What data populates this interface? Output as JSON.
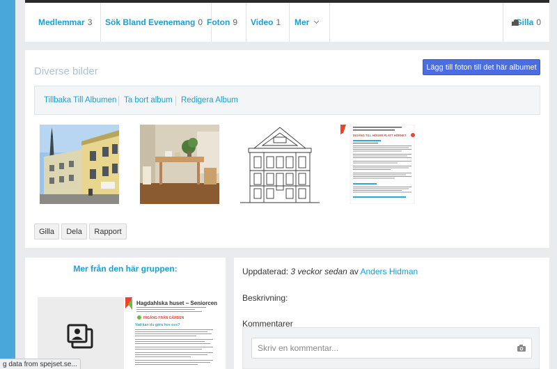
{
  "tabs": [
    {
      "label": "Medlemmar",
      "count": "3"
    },
    {
      "label": "Sök Bland Evenemang",
      "count": "0"
    },
    {
      "label": "Foton",
      "count": "9"
    },
    {
      "label": "Video",
      "count": "1"
    },
    {
      "label": "Mer",
      "count": ""
    }
  ],
  "like": {
    "label": "Gilla",
    "count": "0"
  },
  "album": {
    "title": "Diverse bilder",
    "add_photos_label": "Lägg till foton till det här albumet",
    "nav": [
      "Tillbaka Till Albumen",
      "Ta bort album",
      "Redigera Album"
    ],
    "actions": [
      "Gilla",
      "Dela",
      "Rapport"
    ],
    "doc_heading": "INGÅNG TILL HÖGER PLATT HÖRNET"
  },
  "more_group": {
    "title": "Mer från den här gruppen:",
    "doc_heading": "Hagdahlska huset – Seniorcenter",
    "doc_sub": "INGÅNG FRÅN GÅRDEN",
    "doc_q": "Vad kan du göra hos oss?"
  },
  "details": {
    "updated_label": "Uppdaterad:",
    "updated_time": "3 veckor sedan",
    "updated_by": "av",
    "author": "Anders Hidman",
    "description_label": "Beskrivning:",
    "comments_label": "Kommentarer",
    "comment_placeholder": "Skriv en kommentar..."
  },
  "status_bar": "g data from spejset.se...",
  "colors": {
    "accent": "#1a9fd6",
    "button_primary": "#4b6de0",
    "left_strip": "#4aa8d8"
  }
}
